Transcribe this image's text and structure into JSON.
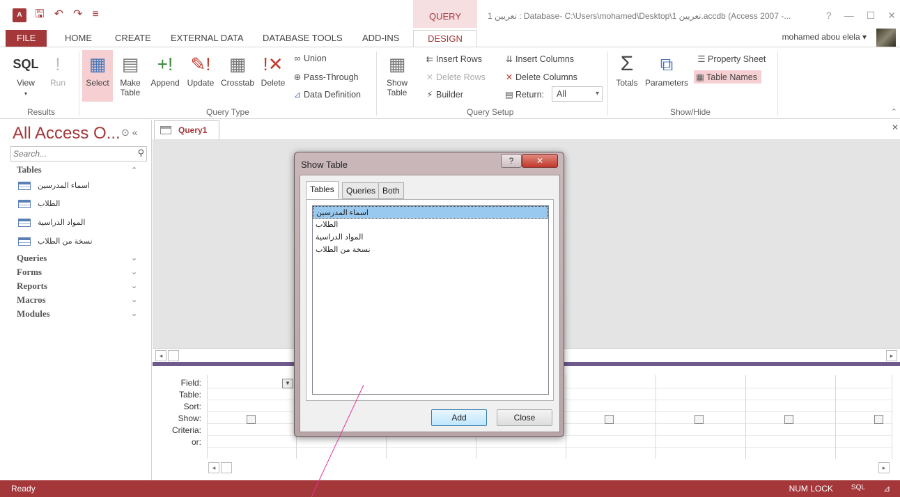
{
  "titlebar": {
    "app_icon": "A",
    "qat_icons": [
      "save-icon",
      "undo-icon",
      "redo-icon",
      "customize-icon"
    ],
    "contextual_label": "QUERY TOOLS",
    "window_title": "تعريين 1 : Database- C:\\Users\\mohamed\\Desktop\\1 تعريين.accdb (Access 2007 -...",
    "controls": [
      "?",
      "—",
      "☐",
      "✕"
    ]
  },
  "ribbon_tabs": [
    "FILE",
    "HOME",
    "CREATE",
    "EXTERNAL DATA",
    "DATABASE TOOLS",
    "ADD-INS",
    "DESIGN"
  ],
  "user": {
    "name": "mohamed abou elela"
  },
  "ribbon": {
    "results": {
      "label": "Results",
      "view": "View",
      "view_icon": "SQL",
      "run": "Run"
    },
    "query_type": {
      "label": "Query Type",
      "select": "Select",
      "make_table_1": "Make",
      "make_table_2": "Table",
      "append": "Append",
      "update": "Update",
      "crosstab": "Crosstab",
      "delete": "Delete",
      "union": "Union",
      "pass_through": "Pass-Through",
      "data_definition": "Data Definition"
    },
    "query_setup": {
      "label": "Query Setup",
      "show_table_1": "Show",
      "show_table_2": "Table",
      "insert_rows": "Insert Rows",
      "delete_rows": "Delete Rows",
      "builder": "Builder",
      "insert_columns": "Insert Columns",
      "delete_columns": "Delete Columns",
      "return_label": "Return:",
      "return_value": "All"
    },
    "show_hide": {
      "label": "Show/Hide",
      "totals": "Totals",
      "parameters": "Parameters",
      "property_sheet": "Property Sheet",
      "table_names": "Table Names"
    }
  },
  "nav": {
    "title": "All Access O...",
    "search_placeholder": "Search...",
    "groups": {
      "tables": "Tables",
      "queries": "Queries",
      "forms": "Forms",
      "reports": "Reports",
      "macros": "Macros",
      "modules": "Modules"
    },
    "tables": [
      "اسماء المدرسين",
      "الطلاب",
      "المواد الدراسية",
      "نسخة من الطلاب"
    ]
  },
  "document": {
    "tab": "Query1",
    "grid_rows": [
      "Field:",
      "Table:",
      "Sort:",
      "Show:",
      "Criteria:",
      "or:"
    ]
  },
  "dialog": {
    "title": "Show Table",
    "help": "?",
    "close_x": "✕",
    "tabs": [
      "Tables",
      "Queries",
      "Both"
    ],
    "items": [
      "اسماء المدرسين",
      "الطلاب",
      "المواد الدراسية",
      "نسخة من الطلاب"
    ],
    "selected_index": 0,
    "add": "Add",
    "close": "Close"
  },
  "status": {
    "text": "Ready",
    "num_lock": "NUM LOCK",
    "sql": "SQL"
  },
  "colors": {
    "accent": "#a4373a",
    "selected_bg": "#f6cfd2",
    "list_selection": "#99c9ef"
  }
}
